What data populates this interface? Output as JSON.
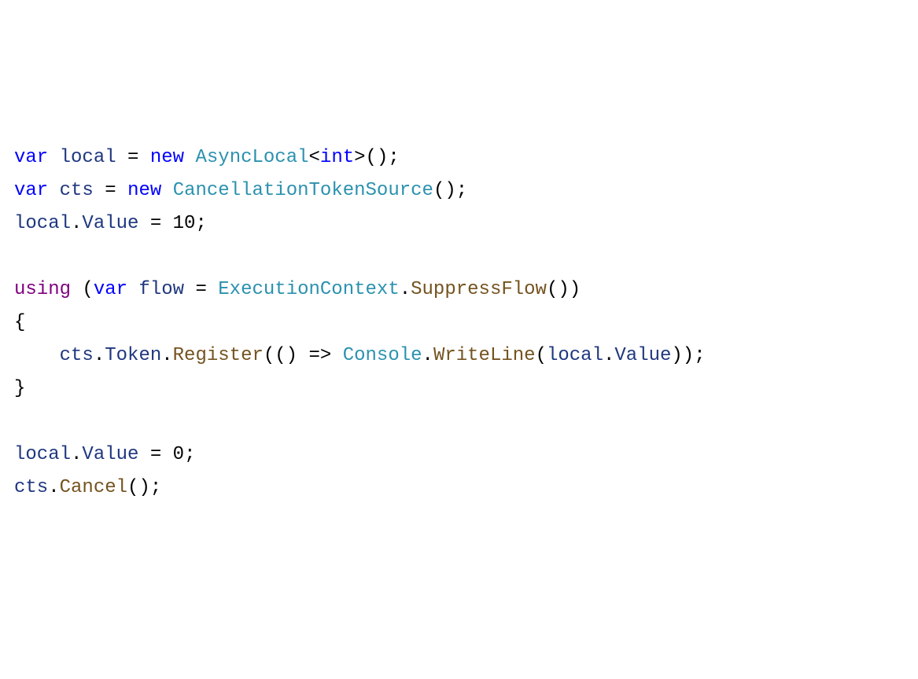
{
  "code": {
    "line1": {
      "kw_var": "var",
      "ident_local": "local",
      "op_eq": "=",
      "kw_new": "new",
      "type_asynclocal": "AsyncLocal",
      "lt": "<",
      "kw_int": "int",
      "gt": ">",
      "parens": "();"
    },
    "line2": {
      "kw_var": "var",
      "ident_cts": "cts",
      "op_eq": "=",
      "kw_new": "new",
      "type_cts": "CancellationTokenSource",
      "parens": "();"
    },
    "line3": {
      "ident_local": "local",
      "dot": ".",
      "prop_value": "Value",
      "op_eq": " = ",
      "num": "10",
      "semi": ";"
    },
    "line5": {
      "kw_using": "using",
      "sp_lp": " (",
      "kw_var": "var",
      "ident_flow": "flow",
      "op_eq": " = ",
      "type_ec": "ExecutionContext",
      "dot": ".",
      "method_sf": "SuppressFlow",
      "parens": "())"
    },
    "line6": {
      "brace": "{"
    },
    "line7": {
      "indent": "    ",
      "ident_cts": "cts",
      "dot1": ".",
      "prop_token": "Token",
      "dot2": ".",
      "method_register": "Register",
      "lp": "(",
      "lambda_parens": "()",
      "arrow": " => ",
      "type_console": "Console",
      "dot3": ".",
      "method_wl": "WriteLine",
      "lp2": "(",
      "ident_local": "local",
      "dot4": ".",
      "prop_value": "Value",
      "rp": "));"
    },
    "line8": {
      "brace": "}"
    },
    "line10": {
      "ident_local": "local",
      "dot": ".",
      "prop_value": "Value",
      "op_eq": " = ",
      "num": "0",
      "semi": ";"
    },
    "line11": {
      "ident_cts": "cts",
      "dot": ".",
      "method_cancel": "Cancel",
      "parens": "();"
    }
  }
}
